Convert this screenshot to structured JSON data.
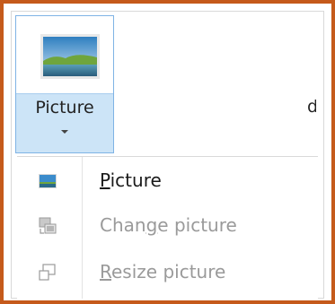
{
  "ribbon": {
    "picture_split_label": "Picture",
    "cut_label_fragment": "d"
  },
  "menu": {
    "items": [
      {
        "label_pre": "",
        "label_key": "P",
        "label_post": "icture",
        "icon": "picture-icon",
        "enabled": true
      },
      {
        "label_pre": "Chan",
        "label_key": "g",
        "label_post": "e picture",
        "icon": "change-picture-icon",
        "enabled": false
      },
      {
        "label_pre": "",
        "label_key": "R",
        "label_post": "esize picture",
        "icon": "resize-picture-icon",
        "enabled": false
      }
    ]
  },
  "colors": {
    "frame": "#c55a1b",
    "split_hover": "#cce4f7",
    "split_border": "#7fb3e5",
    "disabled_text": "#9a9a9a"
  }
}
